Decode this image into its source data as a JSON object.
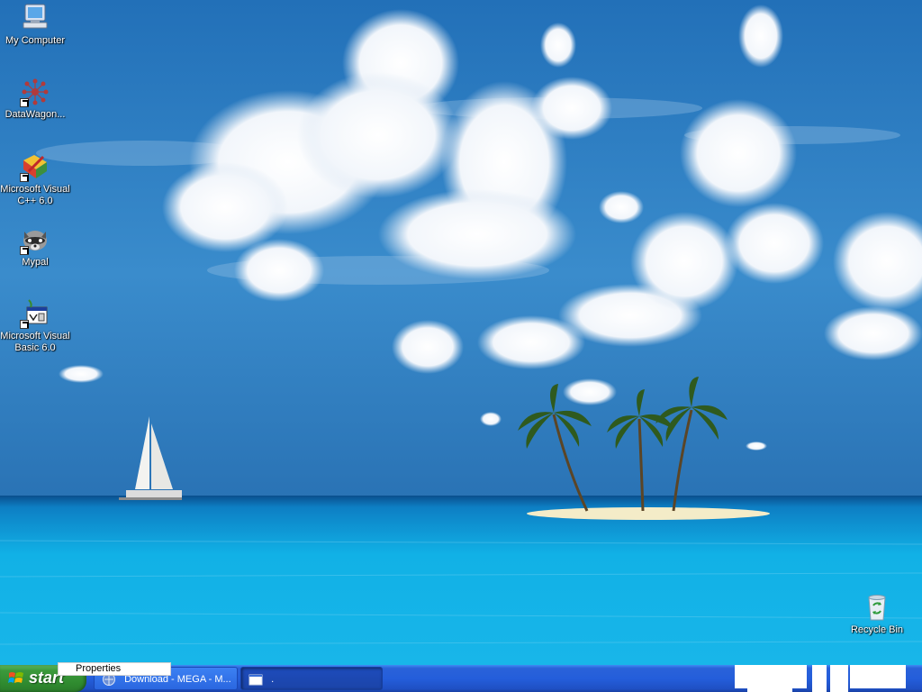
{
  "desktop": {
    "icons": [
      {
        "label": "My Computer",
        "icon": "my-computer-icon"
      },
      {
        "label": "DataWagon...",
        "icon": "datawagon-icon"
      },
      {
        "label": "Microsoft Visual C++ 6.0",
        "icon": "visual-cpp-icon"
      },
      {
        "label": "Mypal",
        "icon": "mypal-raccoon-icon"
      },
      {
        "label": "Microsoft Visual Basic 6.0",
        "icon": "visual-basic-icon"
      },
      {
        "label": "Recycle Bin",
        "icon": "recycle-bin-icon"
      }
    ],
    "wallpaper": "tropical-island-sea-wallpaper"
  },
  "tooltip": {
    "text": "Properties"
  },
  "taskbar": {
    "start_label": "start",
    "buttons": [
      {
        "label": "Download - MEGA - M...",
        "icon": "browser-icon",
        "active": false
      },
      {
        "label": ".",
        "icon": "window-icon",
        "active": true
      }
    ]
  },
  "colors": {
    "taskbar": "#245edb",
    "start": "#3c9a3c",
    "sky": "#2f7ec4",
    "sea": "#15b3e6"
  }
}
